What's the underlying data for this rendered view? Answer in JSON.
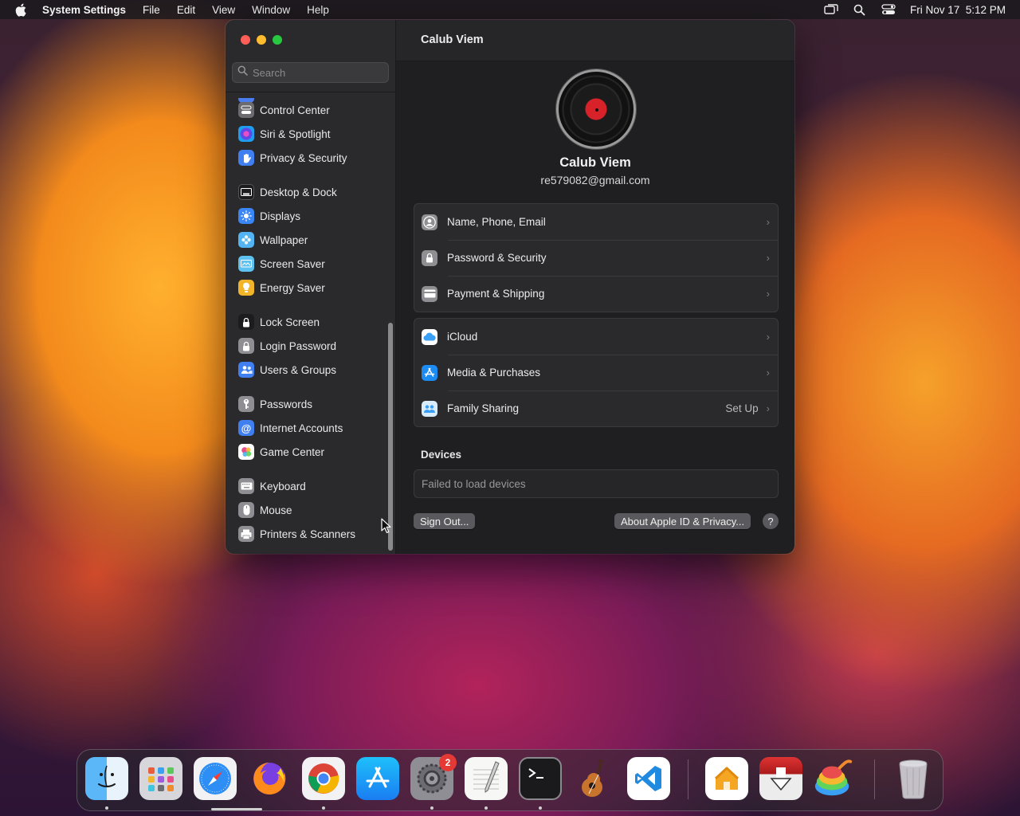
{
  "menubar": {
    "app_name": "System Settings",
    "items": [
      "File",
      "Edit",
      "View",
      "Window",
      "Help"
    ],
    "datetime": "Fri Nov 17  5:12 PM"
  },
  "search": {
    "placeholder": "Search"
  },
  "sidebar": {
    "items": [
      {
        "label": "Control Center",
        "icon": "control-center-icon",
        "color": "#6b6b70"
      },
      {
        "label": "Siri & Spotlight",
        "icon": "siri-icon",
        "color": "#7a4ce0"
      },
      {
        "label": "Privacy & Security",
        "icon": "hand-icon",
        "color": "#3f7ff0"
      },
      {
        "label": "Desktop & Dock",
        "icon": "dock-icon",
        "color": "#1c1c1e"
      },
      {
        "label": "Displays",
        "icon": "sun-icon",
        "color": "#3a86f5"
      },
      {
        "label": "Wallpaper",
        "icon": "flower-icon",
        "color": "#52b4f2"
      },
      {
        "label": "Screen Saver",
        "icon": "screen-saver-icon",
        "color": "#5ec2f0"
      },
      {
        "label": "Energy Saver",
        "icon": "bulb-icon",
        "color": "#f2b52a"
      },
      {
        "label": "Lock Screen",
        "icon": "lock-icon",
        "color": "#1c1c1e"
      },
      {
        "label": "Login Password",
        "icon": "lock-icon",
        "color": "#8e8e93"
      },
      {
        "label": "Users & Groups",
        "icon": "users-icon",
        "color": "#3f7ff0"
      },
      {
        "label": "Passwords",
        "icon": "key-icon",
        "color": "#8e8e93"
      },
      {
        "label": "Internet Accounts",
        "icon": "at-icon",
        "color": "#3f7ff0"
      },
      {
        "label": "Game Center",
        "icon": "game-center-icon",
        "color": "#ffffff"
      },
      {
        "label": "Keyboard",
        "icon": "keyboard-icon",
        "color": "#8e8e93"
      },
      {
        "label": "Mouse",
        "icon": "mouse-icon",
        "color": "#8e8e93"
      },
      {
        "label": "Printers & Scanners",
        "icon": "printer-icon",
        "color": "#8e8e93"
      }
    ]
  },
  "content": {
    "title": "Calub Viem",
    "user_name": "Calub Viem",
    "user_email": "re579082@gmail.com",
    "group1": [
      {
        "label": "Name, Phone, Email",
        "icon": "contact-icon"
      },
      {
        "label": "Password & Security",
        "icon": "lock-icon"
      },
      {
        "label": "Payment & Shipping",
        "icon": "card-icon"
      }
    ],
    "group2": [
      {
        "label": "iCloud",
        "icon": "cloud-icon",
        "value": ""
      },
      {
        "label": "Media & Purchases",
        "icon": "app-store-icon",
        "value": ""
      },
      {
        "label": "Family Sharing",
        "icon": "family-icon",
        "value": "Set Up"
      }
    ],
    "devices_title": "Devices",
    "devices_message": "Failed to load devices",
    "sign_out": "Sign Out...",
    "about": "About Apple ID & Privacy...",
    "help": "?"
  },
  "dock": {
    "apps": [
      "Finder",
      "Launchpad",
      "Safari",
      "Firefox",
      "Chrome",
      "App Store",
      "System Settings",
      "TextEdit",
      "Terminal",
      "GarageBand",
      "Visual Studio Code",
      "Home",
      "Downloader",
      "App Cleaner",
      "Trash"
    ],
    "settings_badge": "2"
  }
}
